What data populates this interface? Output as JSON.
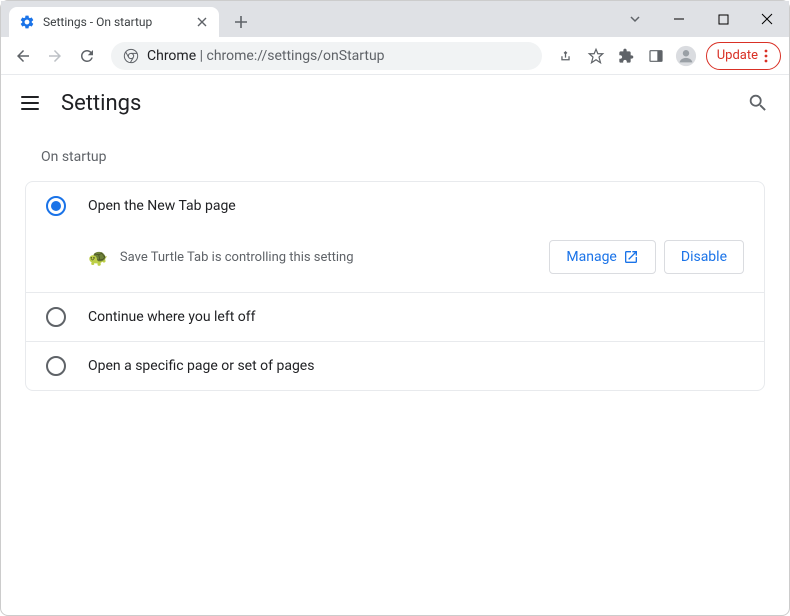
{
  "window": {
    "tab_title": "Settings - On startup"
  },
  "toolbar": {
    "url_host": "Chrome",
    "url_path": "chrome://settings/onStartup",
    "update_label": "Update"
  },
  "header": {
    "title": "Settings"
  },
  "section": {
    "title": "On startup",
    "options": [
      {
        "label": "Open the New Tab page",
        "selected": true
      },
      {
        "label": "Continue where you left off",
        "selected": false
      },
      {
        "label": "Open a specific page or set of pages",
        "selected": false
      }
    ],
    "extension_notice": {
      "icon": "🐢",
      "text": "Save Turtle Tab is controlling this setting",
      "manage_label": "Manage",
      "disable_label": "Disable"
    }
  }
}
